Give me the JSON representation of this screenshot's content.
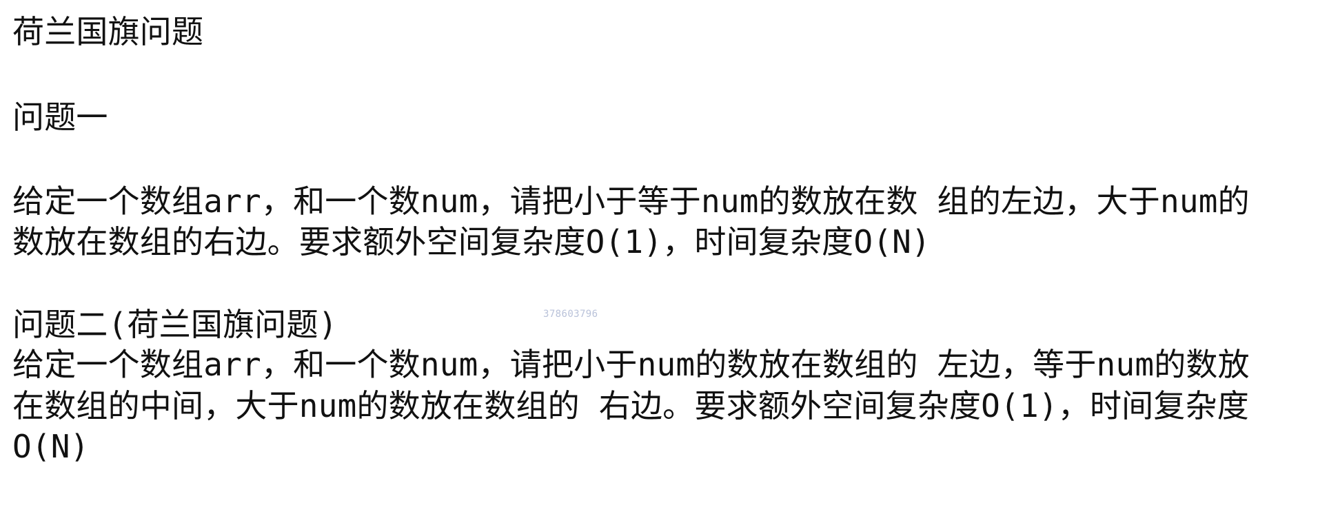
{
  "document": {
    "title": "荷兰国旗问题",
    "problem1": {
      "heading": "问题一",
      "lines": [
        "给定一个数组arr，和一个数num，请把小于等于num的数放在数 组的左边，大于num的",
        "数放在数组的右边。要求额外空间复杂度O(1)，时间复杂度O(N)"
      ]
    },
    "problem2": {
      "heading": "问题二(荷兰国旗问题)",
      "lines": [
        "给定一个数组arr，和一个数num，请把小于num的数放在数组的 左边，等于num的数放",
        "在数组的中间，大于num的数放在数组的 右边。要求额外空间复杂度O(1)，时间复杂度",
        "O(N)"
      ]
    },
    "watermark": "378603796"
  }
}
